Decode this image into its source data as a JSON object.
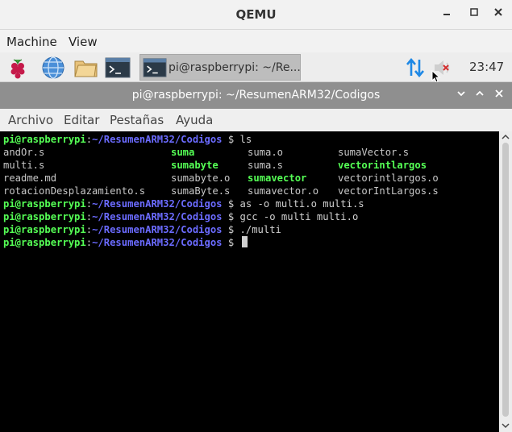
{
  "qemu": {
    "title": "QEMU",
    "menus": [
      "Machine",
      "View"
    ]
  },
  "panel": {
    "task_label": "pi@raspberrypi: ~/Re...",
    "clock": "23:47"
  },
  "terminal": {
    "title": "pi@raspberrypi: ~/ResumenARM32/Codigos",
    "menus": [
      "Archivo",
      "Editar",
      "Pestañas",
      "Ayuda"
    ],
    "prompt_user": "pi@raspberrypi",
    "prompt_colon": ":",
    "prompt_path": "~/ResumenARM32/Codigos",
    "prompt_dollar": " $ ",
    "commands": [
      "ls",
      "as -o multi.o multi.s",
      "gcc -o multi multi.o",
      "./multi"
    ],
    "ls_columns": [
      [
        {
          "name": "andOr.s",
          "exec": false
        },
        {
          "name": "multi.s",
          "exec": false
        },
        {
          "name": "readme.md",
          "exec": false
        },
        {
          "name": "rotacionDesplazamiento.s",
          "exec": false
        }
      ],
      [
        {
          "name": "suma",
          "exec": true
        },
        {
          "name": "sumabyte",
          "exec": true
        },
        {
          "name": "sumabyte.o",
          "exec": false
        },
        {
          "name": "sumaByte.s",
          "exec": false
        }
      ],
      [
        {
          "name": "suma.o",
          "exec": false
        },
        {
          "name": "suma.s",
          "exec": false
        },
        {
          "name": "sumavector",
          "exec": true
        },
        {
          "name": "sumavector.o",
          "exec": false
        }
      ],
      [
        {
          "name": "sumaVector.s",
          "exec": false
        },
        {
          "name": "vectorintlargos",
          "exec": true
        },
        {
          "name": "vectorintlargos.o",
          "exec": false
        },
        {
          "name": "vectorIntLargos.s",
          "exec": false
        }
      ]
    ]
  },
  "colors": {
    "prompt_user": "#55ff55",
    "prompt_path": "#6b6bff",
    "terminal_bg": "#000000"
  }
}
